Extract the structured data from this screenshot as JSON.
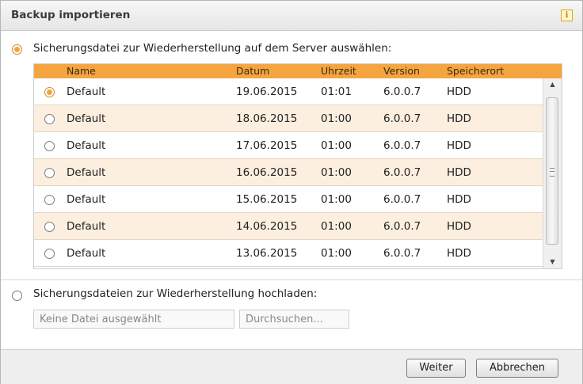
{
  "dialog": {
    "title": "Backup importieren",
    "info_icon": "i"
  },
  "option_server": {
    "label": "Sicherungsdatei zur Wiederherstellung auf dem Server auswählen:",
    "selected": true
  },
  "table": {
    "columns": [
      "Name",
      "Datum",
      "Uhrzeit",
      "Version",
      "Speicherort"
    ],
    "rows": [
      {
        "name": "Default",
        "datum": "19.06.2015",
        "uhrzeit": "01:01",
        "version": "6.0.0.7",
        "speicherort": "HDD",
        "selected": true
      },
      {
        "name": "Default",
        "datum": "18.06.2015",
        "uhrzeit": "01:00",
        "version": "6.0.0.7",
        "speicherort": "HDD",
        "selected": false
      },
      {
        "name": "Default",
        "datum": "17.06.2015",
        "uhrzeit": "01:00",
        "version": "6.0.0.7",
        "speicherort": "HDD",
        "selected": false
      },
      {
        "name": "Default",
        "datum": "16.06.2015",
        "uhrzeit": "01:00",
        "version": "6.0.0.7",
        "speicherort": "HDD",
        "selected": false
      },
      {
        "name": "Default",
        "datum": "15.06.2015",
        "uhrzeit": "01:00",
        "version": "6.0.0.7",
        "speicherort": "HDD",
        "selected": false
      },
      {
        "name": "Default",
        "datum": "14.06.2015",
        "uhrzeit": "01:00",
        "version": "6.0.0.7",
        "speicherort": "HDD",
        "selected": false
      },
      {
        "name": "Default",
        "datum": "13.06.2015",
        "uhrzeit": "01:00",
        "version": "6.0.0.7",
        "speicherort": "HDD",
        "selected": false
      }
    ]
  },
  "option_upload": {
    "label": "Sicherungsdateien zur Wiederherstellung hochladen:",
    "selected": false,
    "file_field": "Keine Datei ausgewählt",
    "browse_button": "Durchsuchen..."
  },
  "footer": {
    "next_button": "Weiter",
    "cancel_button": "Abbrechen"
  },
  "colors": {
    "accent": "#f4a540",
    "row_alt": "#fcefe0"
  }
}
